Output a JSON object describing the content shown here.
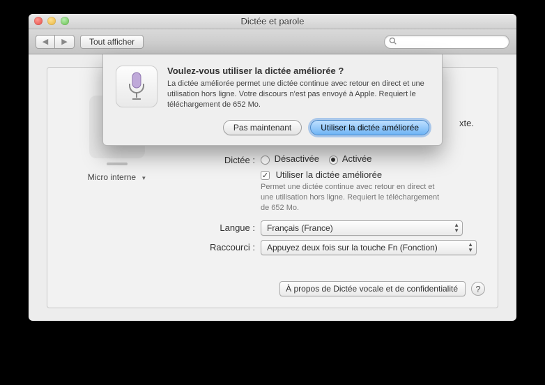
{
  "window": {
    "title": "Dictée et parole"
  },
  "toolbar": {
    "show_all": "Tout afficher",
    "search_placeholder": ""
  },
  "background_text_fragment": "xte.",
  "sidebar": {
    "input_label": "Micro interne"
  },
  "form": {
    "dictation_label": "Dictée :",
    "radio_off": "Désactivée",
    "radio_on": "Activée",
    "enhanced_checkbox": "Utiliser la dictée améliorée",
    "enhanced_desc": "Permet une dictée continue avec retour en direct et une utilisation hors ligne. Requiert le téléchargement de 652 Mo.",
    "language_label": "Langue :",
    "language_value": "Français (France)",
    "shortcut_label": "Raccourci :",
    "shortcut_value": "Appuyez deux fois sur la touche Fn (Fonction)"
  },
  "footer": {
    "about_button": "À propos de Dictée vocale et de confidentialité"
  },
  "sheet": {
    "title": "Voulez-vous utiliser la dictée améliorée ?",
    "body": "La dictée améliorée permet une dictée continue avec retour en direct et une utilisation hors ligne. Votre discours n'est pas envoyé à Apple. Requiert le téléchargement de 652 Mo.",
    "not_now": "Pas maintenant",
    "use_enhanced": "Utiliser la dictée améliorée"
  }
}
